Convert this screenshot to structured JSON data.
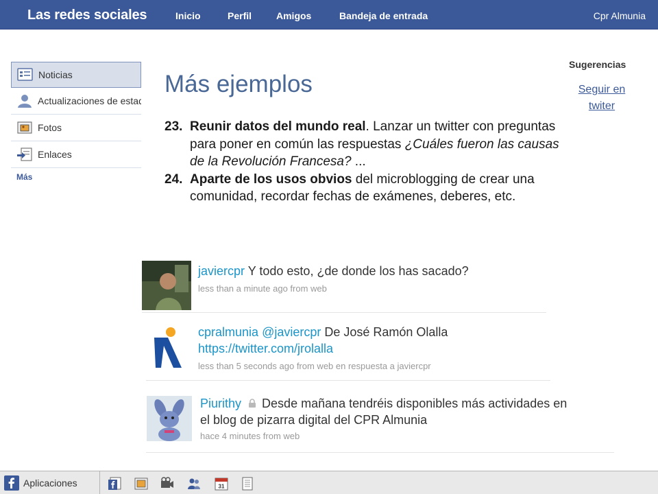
{
  "topbar": {
    "brand": "Las redes sociales",
    "nav": [
      "Inicio",
      "Perfil",
      "Amigos",
      "Bandeja de entrada"
    ],
    "user": "Cpr Almunia"
  },
  "sidebar": {
    "items": [
      {
        "label": "Noticias",
        "icon": "news-feed-icon"
      },
      {
        "label": "Actualizaciones de estado",
        "icon": "status-updates-icon"
      },
      {
        "label": "Fotos",
        "icon": "photos-icon"
      },
      {
        "label": "Enlaces",
        "icon": "links-icon"
      }
    ],
    "more": "Más"
  },
  "main": {
    "title": "Más ejemplos",
    "items": [
      {
        "num": "23.",
        "bold": "Reunir datos del mundo real",
        "text1": ". Lanzar un twitter con preguntas para poner en común las respuestas ",
        "italic": "¿Cuáles fueron las causas de la Revolución Francesa?",
        "text2": " ..."
      },
      {
        "num": "24.",
        "bold": "Aparte de los usos obvios",
        "text1": " del microblogging de crear una comunidad, recordar fechas de exámenes, deberes, etc.",
        "italic": "",
        "text2": ""
      }
    ]
  },
  "suggestions": {
    "heading": "Sugerencias",
    "link": "Seguir en twiter"
  },
  "tweets": [
    {
      "user": "javiercpr",
      "mention": "",
      "text": " Y todo esto, ¿de donde los has sacado?",
      "url": "",
      "meta": "less than a minute ago from web",
      "protected": false
    },
    {
      "user": "cpralmunia",
      "mention": "@javiercpr",
      "text": " De José Ramón Olalla",
      "url": "https://twitter.com/jrolalla",
      "meta": "less than 5 seconds ago from web en respuesta a javiercpr",
      "protected": false
    },
    {
      "user": "Piurithy",
      "mention": "",
      "text": " Desde mañana tendréis disponibles más actividades en",
      "text_line2": "el blog de pizarra digital del CPR Almunia",
      "url": "",
      "meta": "hace 4 minutes from web",
      "protected": true
    }
  ],
  "bottombar": {
    "apps_label": "Aplicaciones",
    "icons": [
      "facebook-page-icon",
      "photos-icon",
      "video-icon",
      "friends-icon",
      "calendar-icon",
      "notes-icon"
    ],
    "calendar_day": "31"
  },
  "colors": {
    "brand_blue": "#3b5998",
    "title_blue": "#4a6896",
    "twitter_blue": "#1b95c8"
  }
}
